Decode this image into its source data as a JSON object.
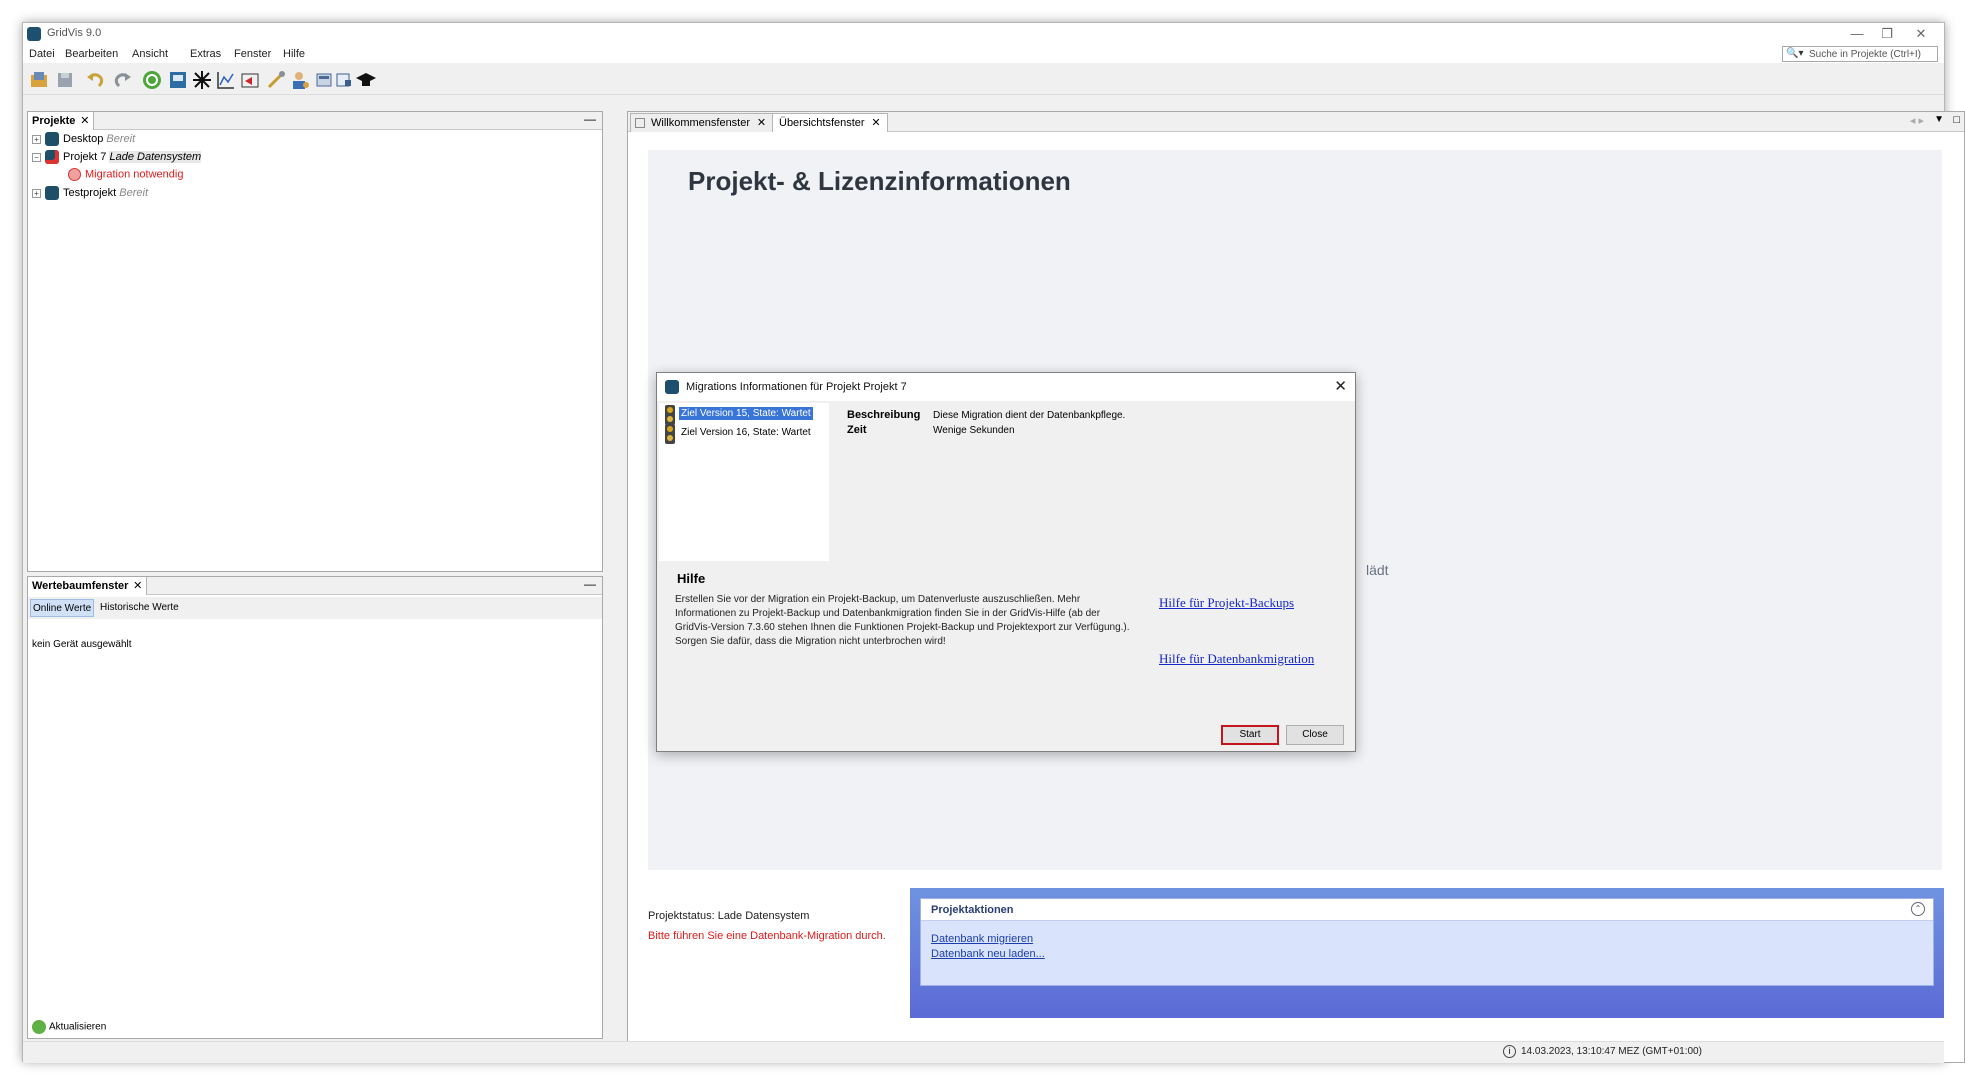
{
  "app": {
    "title": "GridVis 9.0"
  },
  "window_controls": {
    "minimize": "—",
    "restore": "❐",
    "close": "✕"
  },
  "menu": [
    "Datei",
    "Bearbeiten",
    "Ansicht",
    "Extras",
    "Fenster",
    "Hilfe"
  ],
  "search": {
    "placeholder": "Suche in Projekte (Ctrl+I)"
  },
  "toolbar_icons": [
    "open-project-icon",
    "save-icon",
    "undo-icon",
    "redo-icon",
    "sync-icon",
    "device-icon",
    "topology-icon",
    "graph-icon",
    "import-icon",
    "tools-icon",
    "user-icon",
    "calculator-icon",
    "report-icon",
    "academy-icon"
  ],
  "projects_panel": {
    "tab": "Projekte",
    "items": [
      {
        "name": "Desktop",
        "status": "Bereit"
      },
      {
        "name": "Projekt 7",
        "status": "Lade Datensystem",
        "child": "Migration notwendig"
      },
      {
        "name": "Testprojekt",
        "status": "Bereit"
      }
    ]
  },
  "values_panel": {
    "tab": "Wertebaumfenster",
    "tabs": [
      "Online Werte",
      "Historische Werte"
    ],
    "no_device": "kein Gerät ausgewählt",
    "refresh": "Aktualisieren"
  },
  "doc_tabs": [
    "Willkommensfenster",
    "Übersichtsfenster"
  ],
  "overview": {
    "title": "Projekt- & Lizenzinformationen",
    "loading_fragment": "lädt",
    "project_status": "Projektstatus: Lade Datensystem",
    "warning": "Bitte führen Sie eine Datenbank-Migration durch.",
    "actions_title": "Projektaktionen",
    "actions": [
      "Datenbank migrieren",
      "Datenbank neu laden..."
    ]
  },
  "dialog": {
    "title": "Migrations Informationen für Projekt Projekt 7",
    "migrations": [
      "Ziel Version 15, State: Wartet",
      "Ziel Version 16, State: Wartet"
    ],
    "description_label": "Beschreibung",
    "description_value": "Diese Migration dient der Datenbankpflege.",
    "time_label": "Zeit",
    "time_value": "Wenige Sekunden",
    "help_title": "Hilfe",
    "help_text": "Erstellen Sie vor der Migration ein Projekt-Backup, um Datenverluste auszuschließen. Mehr Informationen zu Projekt-Backup und Datenbankmigration finden Sie in der GridVis-Hilfe (ab der GridVis-Version 7.3.60 stehen Ihnen die Funktionen Projekt-Backup und Projektexport zur Verfügung.). Sorgen Sie dafür, dass die Migration nicht unterbrochen wird!",
    "link_backups": "Hilfe für Projekt-Backups",
    "link_migration": "Hilfe für Datenbankmigration",
    "start": "Start",
    "close": "Close"
  },
  "statusbar": {
    "datetime": "14.03.2023, 13:10:47 MEZ (GMT+01:00)"
  },
  "colors": {
    "accent_red": "#c4161c",
    "warning_red": "#e01b1b",
    "link_blue": "#1428c8",
    "selection": "#3875d7"
  }
}
